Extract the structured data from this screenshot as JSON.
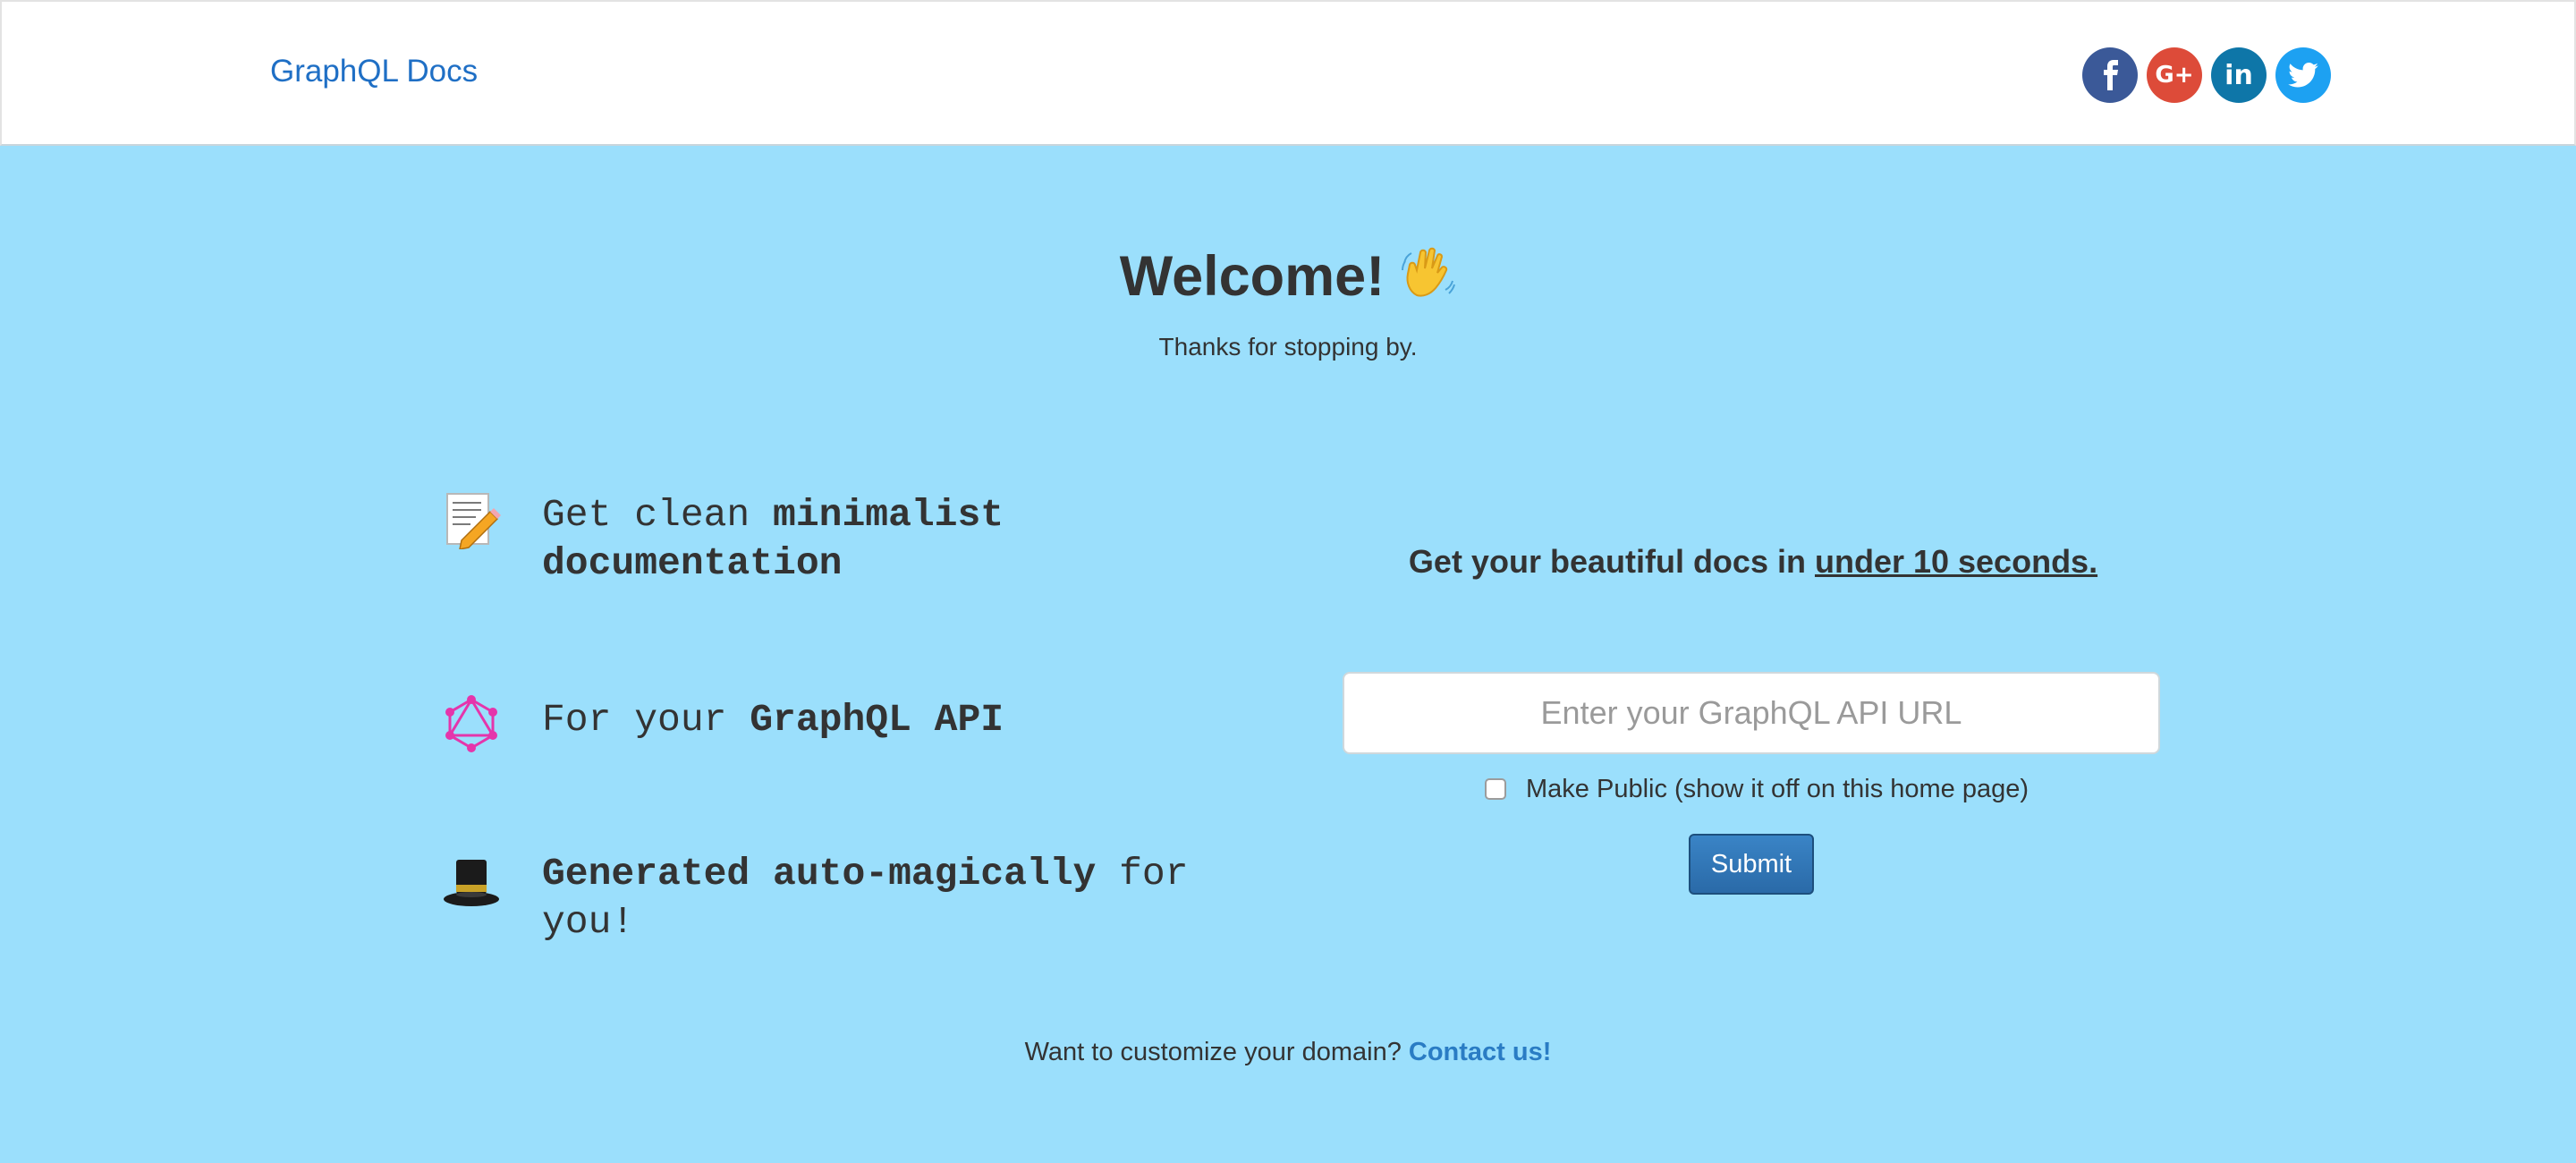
{
  "header": {
    "brand": "GraphQL Docs",
    "social": [
      {
        "name": "facebook-icon",
        "color": "#3b5998"
      },
      {
        "name": "google-plus-icon",
        "color": "#dd4b39",
        "label": "G+"
      },
      {
        "name": "linkedin-icon",
        "color": "#0e76a8",
        "label": "in"
      },
      {
        "name": "twitter-icon",
        "color": "#1da1f2"
      }
    ]
  },
  "hero": {
    "title": "Welcome!",
    "subtitle": "Thanks for stopping by."
  },
  "features": [
    {
      "icon": "memo-icon",
      "plain": "Get clean ",
      "bold": "minimalist documentation",
      "suffix": ""
    },
    {
      "icon": "graphql-logo-icon",
      "plain": "For your ",
      "bold": "GraphQL API",
      "suffix": ""
    },
    {
      "icon": "top-hat-icon",
      "plain": "",
      "bold": "Generated auto-magically",
      "suffix": " for you!"
    }
  ],
  "form": {
    "tagline_prefix": "Get your beautiful docs in ",
    "tagline_emphasis": "under 10 seconds.",
    "url_placeholder": "Enter your GraphQL API URL",
    "url_value": "",
    "public_label": "Make Public (show it off on this home page)",
    "public_checked": false,
    "submit_label": "Submit"
  },
  "footer": {
    "prompt": "Want to customize your domain? ",
    "link": "Contact us!"
  },
  "colors": {
    "background": "#9bdffc",
    "brand": "#1f6fc5",
    "link": "#2a7cc4",
    "submit": "#2a6aa8"
  }
}
